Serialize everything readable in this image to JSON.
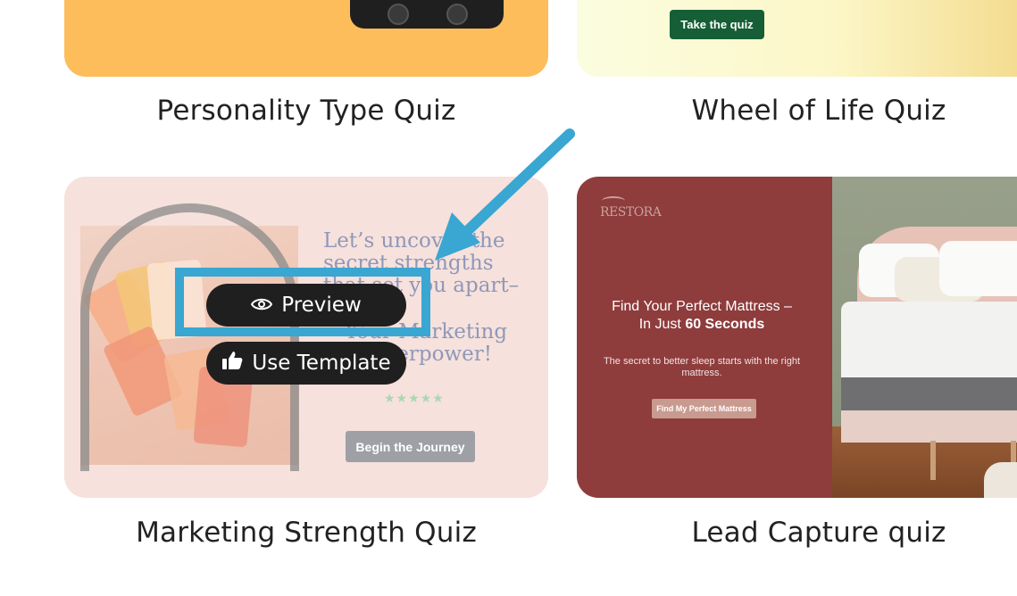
{
  "cards": [
    {
      "title": "Personality Type Quiz"
    },
    {
      "title": "Wheel of Life Quiz",
      "cta": "Take the quiz"
    },
    {
      "title": "Marketing Strength Quiz",
      "headline": "Let’s uncover the secret strengths that set you apart–",
      "headline2": "Your Marketing superpower!",
      "rating": "★★★★★",
      "cta": "Begin the Journey",
      "overlay": {
        "preview": "Preview",
        "use_template": "Use Template"
      }
    },
    {
      "title": "Lead Capture quiz",
      "logo": "RESTORA",
      "headline_prefix": "Find Your Perfect Mattress –",
      "headline_line2": "In Just ",
      "headline_bold": "60 Seconds",
      "subtext": "The secret to better sleep starts with the right mattress.",
      "cta": "Find My Perfect Mattress"
    }
  ],
  "annotation": {
    "arrow_color": "#3aa6d2"
  },
  "colors": {
    "orange": "#fdbd5a",
    "quiz_green": "#155e36",
    "lead_bg": "#8e3c3c",
    "pink_bg": "#f6e1dc"
  },
  "icons": {
    "preview": "eye-icon",
    "use_template": "thumbs-up-icon"
  }
}
